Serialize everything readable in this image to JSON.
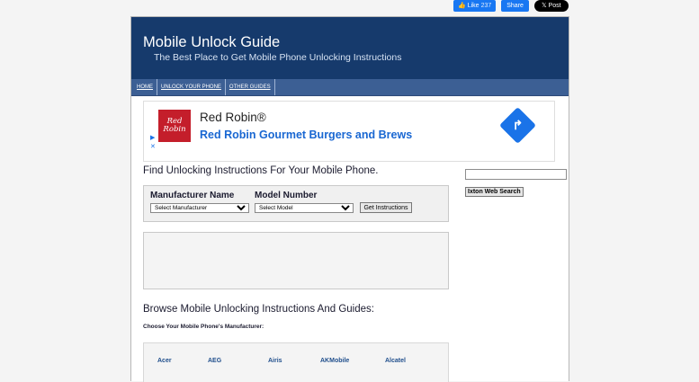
{
  "social": {
    "like_label": "Like",
    "like_count": "237",
    "share_label": "Share",
    "post_label": "Post"
  },
  "header": {
    "title": "Mobile Unlock Guide",
    "tagline": "The Best Place to Get Mobile Phone Unlocking Instructions",
    "bg_color": "#163a6c"
  },
  "nav": [
    "HOME",
    "UNLOCK YOUR PHONE",
    "OTHER GUIDES"
  ],
  "ad": {
    "logo_line1": "Red",
    "logo_line2": "Robin",
    "title": "Red Robin®",
    "subtitle": "Red Robin Gourmet Burgers and Brews",
    "brand_color": "#c41e2b",
    "accent_color": "#1a73e8"
  },
  "finder": {
    "heading": "Find Unlocking Instructions For Your Mobile Phone.",
    "manufacturer_label": "Manufacturer Name",
    "manufacturer_selected": "Select Manufacturer",
    "model_label": "Model Number",
    "model_selected": "Select Model",
    "button_label": "Get Instructions"
  },
  "sidebar": {
    "search_button": "Ixton Web Search"
  },
  "browse": {
    "heading": "Browse Mobile Unlocking Instructions And Guides:",
    "choose_label": "Choose Your Mobile Phone's Manufacturer:",
    "manufacturers": [
      "Acer",
      "AEG",
      "Airis",
      "AKMobile",
      "Alcatel"
    ]
  }
}
